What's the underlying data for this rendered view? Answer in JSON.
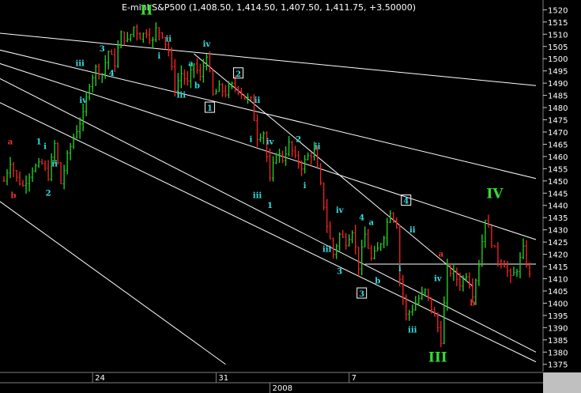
{
  "chart_data": {
    "type": "candlestick",
    "title": "E-mini S&P500 (1,408.50, 1,414.50, 1,407.50, 1,411.75, +3.50000)",
    "ylim": [
      1372,
      1524
    ],
    "grid": false,
    "background": "#000000",
    "colors": {
      "up": "#22cc22",
      "down": "#ee2222",
      "trendlines": "#ffffff",
      "wave_label_cyan": "#33dddd",
      "wave_label_red": "#ee3333",
      "wave_label_green": "#33dd33",
      "axis_text": "#ffffff",
      "axis_bg": "#c0c0c0"
    },
    "y_ticks": [
      1375,
      1380,
      1385,
      1390,
      1395,
      1400,
      1405,
      1410,
      1415,
      1420,
      1425,
      1430,
      1435,
      1440,
      1445,
      1450,
      1455,
      1460,
      1465,
      1470,
      1475,
      1480,
      1485,
      1490,
      1495,
      1500,
      1505,
      1510,
      1515,
      1520
    ],
    "x_axis": {
      "ticks": [
        {
          "label": "24",
          "index": 28
        },
        {
          "label": "31",
          "index": 67
        },
        {
          "label": "7",
          "index": 109
        }
      ],
      "year_label": {
        "label": "2008",
        "index": 84
      }
    },
    "n_bars": 170,
    "price_path": [
      [
        0,
        1450
      ],
      [
        2,
        1458
      ],
      [
        4,
        1451
      ],
      [
        6,
        1448
      ],
      [
        9,
        1455
      ],
      [
        12,
        1457
      ],
      [
        14,
        1452
      ],
      [
        16,
        1465
      ],
      [
        18,
        1449
      ],
      [
        20,
        1460
      ],
      [
        22,
        1468
      ],
      [
        25,
        1477
      ],
      [
        27,
        1490
      ],
      [
        29,
        1496
      ],
      [
        31,
        1494
      ],
      [
        33,
        1503
      ],
      [
        35,
        1498
      ],
      [
        37,
        1510
      ],
      [
        39,
        1507
      ],
      [
        41,
        1513
      ],
      [
        43,
        1509
      ],
      [
        45,
        1511
      ],
      [
        47,
        1507
      ],
      [
        48,
        1512
      ],
      [
        50,
        1510
      ],
      [
        52,
        1503
      ],
      [
        54,
        1488
      ],
      [
        56,
        1494
      ],
      [
        58,
        1490
      ],
      [
        60,
        1498
      ],
      [
        62,
        1492
      ],
      [
        64,
        1502
      ],
      [
        66,
        1485
      ],
      [
        68,
        1488
      ],
      [
        70,
        1486
      ],
      [
        72,
        1489
      ],
      [
        74,
        1488
      ],
      [
        76,
        1484
      ],
      [
        78,
        1483
      ],
      [
        80,
        1468
      ],
      [
        82,
        1470
      ],
      [
        84,
        1450
      ],
      [
        86,
        1462
      ],
      [
        88,
        1459
      ],
      [
        90,
        1465
      ],
      [
        92,
        1459
      ],
      [
        94,
        1456
      ],
      [
        96,
        1460
      ],
      [
        98,
        1462
      ],
      [
        100,
        1448
      ],
      [
        102,
        1432
      ],
      [
        104,
        1420
      ],
      [
        106,
        1428
      ],
      [
        108,
        1425
      ],
      [
        110,
        1430
      ],
      [
        112,
        1415
      ],
      [
        114,
        1428
      ],
      [
        116,
        1418
      ],
      [
        118,
        1422
      ],
      [
        120,
        1428
      ],
      [
        122,
        1438
      ],
      [
        124,
        1432
      ],
      [
        125,
        1410
      ],
      [
        127,
        1395
      ],
      [
        129,
        1398
      ],
      [
        131,
        1402
      ],
      [
        133,
        1405
      ],
      [
        135,
        1398
      ],
      [
        137,
        1390
      ],
      [
        138,
        1385
      ],
      [
        140,
        1414
      ],
      [
        142,
        1412
      ],
      [
        144,
        1408
      ],
      [
        146,
        1412
      ],
      [
        148,
        1404
      ],
      [
        150,
        1416
      ],
      [
        152,
        1435
      ],
      [
        154,
        1425
      ],
      [
        156,
        1418
      ],
      [
        158,
        1416
      ],
      [
        160,
        1410
      ],
      [
        162,
        1414
      ],
      [
        164,
        1422
      ],
      [
        166,
        1411
      ]
    ],
    "trendlines": [
      {
        "from": [
          -6,
          1511
        ],
        "to": [
          168,
          1489
        ]
      },
      {
        "from": [
          -6,
          1505
        ],
        "to": [
          168,
          1451
        ]
      },
      {
        "from": [
          -6,
          1500
        ],
        "to": [
          168,
          1426
        ]
      },
      {
        "from": [
          -6,
          1495
        ],
        "to": [
          168,
          1380
        ]
      },
      {
        "from": [
          -6,
          1485
        ],
        "to": [
          168,
          1376
        ]
      },
      {
        "from": [
          -6,
          1446
        ],
        "to": [
          70,
          1375
        ]
      },
      {
        "from": [
          60,
          1502
        ],
        "to": [
          148,
          1407
        ]
      },
      {
        "from": [
          114,
          1416
        ],
        "to": [
          168,
          1416
        ]
      }
    ],
    "wave_labels": [
      {
        "text": "II",
        "index": 45,
        "price": 1518,
        "color": "green",
        "size": "big"
      },
      {
        "text": "IV",
        "index": 155,
        "price": 1443,
        "color": "green",
        "size": "big"
      },
      {
        "text": "III",
        "index": 137,
        "price": 1376,
        "color": "green",
        "size": "big"
      },
      {
        "text": "a",
        "index": 2,
        "price": 1465,
        "color": "red",
        "size": "small"
      },
      {
        "text": "b",
        "index": 3,
        "price": 1443,
        "color": "red",
        "size": "small"
      },
      {
        "text": "a",
        "index": 138,
        "price": 1419,
        "color": "red",
        "size": "small"
      },
      {
        "text": "b",
        "index": 148,
        "price": 1399,
        "color": "red",
        "size": "small"
      },
      {
        "text": "1",
        "index": 11,
        "price": 1465,
        "color": "cyan",
        "size": "small"
      },
      {
        "text": "i",
        "index": 13,
        "price": 1463,
        "color": "cyan",
        "size": "small"
      },
      {
        "text": "ii",
        "index": 16,
        "price": 1456,
        "color": "cyan",
        "size": "small"
      },
      {
        "text": "2",
        "index": 14,
        "price": 1444,
        "color": "cyan",
        "size": "small"
      },
      {
        "text": "iii",
        "index": 24,
        "price": 1497,
        "color": "cyan",
        "size": "small"
      },
      {
        "text": "iv",
        "index": 25,
        "price": 1482,
        "color": "cyan",
        "size": "small"
      },
      {
        "text": "3",
        "index": 31,
        "price": 1503,
        "color": "cyan",
        "size": "small"
      },
      {
        "text": "4",
        "index": 34,
        "price": 1493,
        "color": "cyan",
        "size": "small"
      },
      {
        "text": "ii",
        "index": 52,
        "price": 1507,
        "color": "cyan",
        "size": "small"
      },
      {
        "text": "i",
        "index": 49,
        "price": 1500,
        "color": "cyan",
        "size": "small"
      },
      {
        "text": "iv",
        "index": 64,
        "price": 1505,
        "color": "cyan",
        "size": "small"
      },
      {
        "text": "a",
        "index": 59,
        "price": 1497,
        "color": "cyan",
        "size": "small"
      },
      {
        "text": "b",
        "index": 61,
        "price": 1488,
        "color": "cyan",
        "size": "small"
      },
      {
        "text": "iii",
        "index": 56,
        "price": 1484,
        "color": "cyan",
        "size": "small"
      },
      {
        "text": "ii",
        "index": 80,
        "price": 1482,
        "color": "cyan",
        "size": "small"
      },
      {
        "text": "i",
        "index": 78,
        "price": 1466,
        "color": "cyan",
        "size": "small"
      },
      {
        "text": "iv",
        "index": 84,
        "price": 1465,
        "color": "cyan",
        "size": "small"
      },
      {
        "text": "iii",
        "index": 80,
        "price": 1443,
        "color": "cyan",
        "size": "small"
      },
      {
        "text": "1",
        "index": 84,
        "price": 1439,
        "color": "cyan",
        "size": "small"
      },
      {
        "text": "2",
        "index": 93,
        "price": 1466,
        "color": "cyan",
        "size": "small"
      },
      {
        "text": "ii",
        "index": 99,
        "price": 1463,
        "color": "cyan",
        "size": "small"
      },
      {
        "text": "i",
        "index": 95,
        "price": 1447,
        "color": "cyan",
        "size": "small"
      },
      {
        "text": "iv",
        "index": 106,
        "price": 1437,
        "color": "cyan",
        "size": "small"
      },
      {
        "text": "4",
        "index": 113,
        "price": 1434,
        "color": "cyan",
        "size": "small"
      },
      {
        "text": "a",
        "index": 116,
        "price": 1432,
        "color": "cyan",
        "size": "small"
      },
      {
        "text": "ii",
        "index": 129,
        "price": 1429,
        "color": "cyan",
        "size": "small"
      },
      {
        "text": "iii",
        "index": 102,
        "price": 1421,
        "color": "cyan",
        "size": "small"
      },
      {
        "text": "3",
        "index": 106,
        "price": 1412,
        "color": "cyan",
        "size": "small"
      },
      {
        "text": "b",
        "index": 118,
        "price": 1408,
        "color": "cyan",
        "size": "small"
      },
      {
        "text": "i",
        "index": 125,
        "price": 1413,
        "color": "cyan",
        "size": "small"
      },
      {
        "text": "iv",
        "index": 137,
        "price": 1409,
        "color": "cyan",
        "size": "small"
      },
      {
        "text": "iii",
        "index": 129,
        "price": 1388,
        "color": "cyan",
        "size": "small"
      }
    ],
    "boxed_labels": [
      {
        "text": "1",
        "index": 65,
        "price": 1480
      },
      {
        "text": "2",
        "index": 74,
        "price": 1494
      },
      {
        "text": "3",
        "index": 113,
        "price": 1404
      },
      {
        "text": "4",
        "index": 127,
        "price": 1442
      }
    ]
  }
}
